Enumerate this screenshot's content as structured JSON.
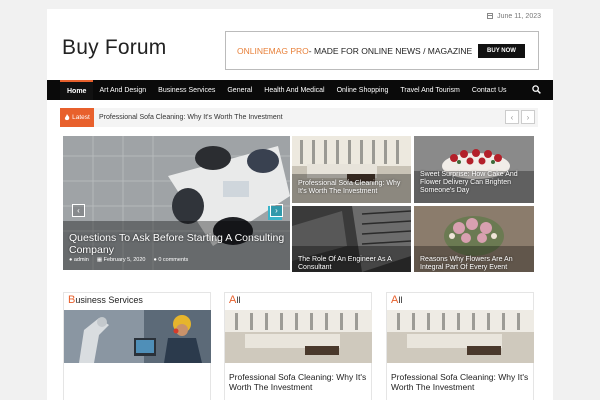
{
  "topbar": {
    "date": "June 11, 2023"
  },
  "header": {
    "site_title": "Buy Forum",
    "ad": {
      "brand": "ONLINEMAG PRO",
      "text": " - MADE FOR ONLINE NEWS / MAGAZINE",
      "button": "BUY NOW"
    }
  },
  "nav": {
    "items": [
      {
        "label": "Home"
      },
      {
        "label": "Art And Design"
      },
      {
        "label": "Business Services"
      },
      {
        "label": "General"
      },
      {
        "label": "Health And Medical"
      },
      {
        "label": "Online Shopping"
      },
      {
        "label": "Travel And Tourism"
      },
      {
        "label": "Contact Us"
      }
    ]
  },
  "ticker": {
    "label": "Latest",
    "headline": "Professional Sofa Cleaning: Why It's Worth The Investment",
    "prev": "‹",
    "next": "›"
  },
  "featured": {
    "main": {
      "title": "Questions To Ask Before Starting A Consulting Company",
      "author": "admin",
      "date": "February 5, 2020",
      "comments": "0 comments",
      "prev": "‹",
      "next": "›"
    },
    "tiles": [
      {
        "title": "Professional Sofa Cleaning: Why It's Worth The Investment"
      },
      {
        "title": "Sweet Surprise: How Cake And Flower Delivery Can Brighten Someone's Day"
      },
      {
        "title": "The Role Of An Engineer As A Consultant"
      },
      {
        "title": "Reasons Why Flowers Are An Integral Part Of Every Event"
      }
    ]
  },
  "sections": [
    {
      "first": "B",
      "rest": "usiness Services",
      "title": ""
    },
    {
      "first": "A",
      "rest": "ll",
      "title": "Professional Sofa Cleaning: Why It's Worth The Investment"
    },
    {
      "first": "A",
      "rest": "ll",
      "title": "Professional Sofa Cleaning: Why It's Worth The Investment"
    }
  ],
  "colors": {
    "accent": "#e8602c",
    "nav_bg": "#0a0a0a",
    "ad_brand": "#e8813a"
  }
}
